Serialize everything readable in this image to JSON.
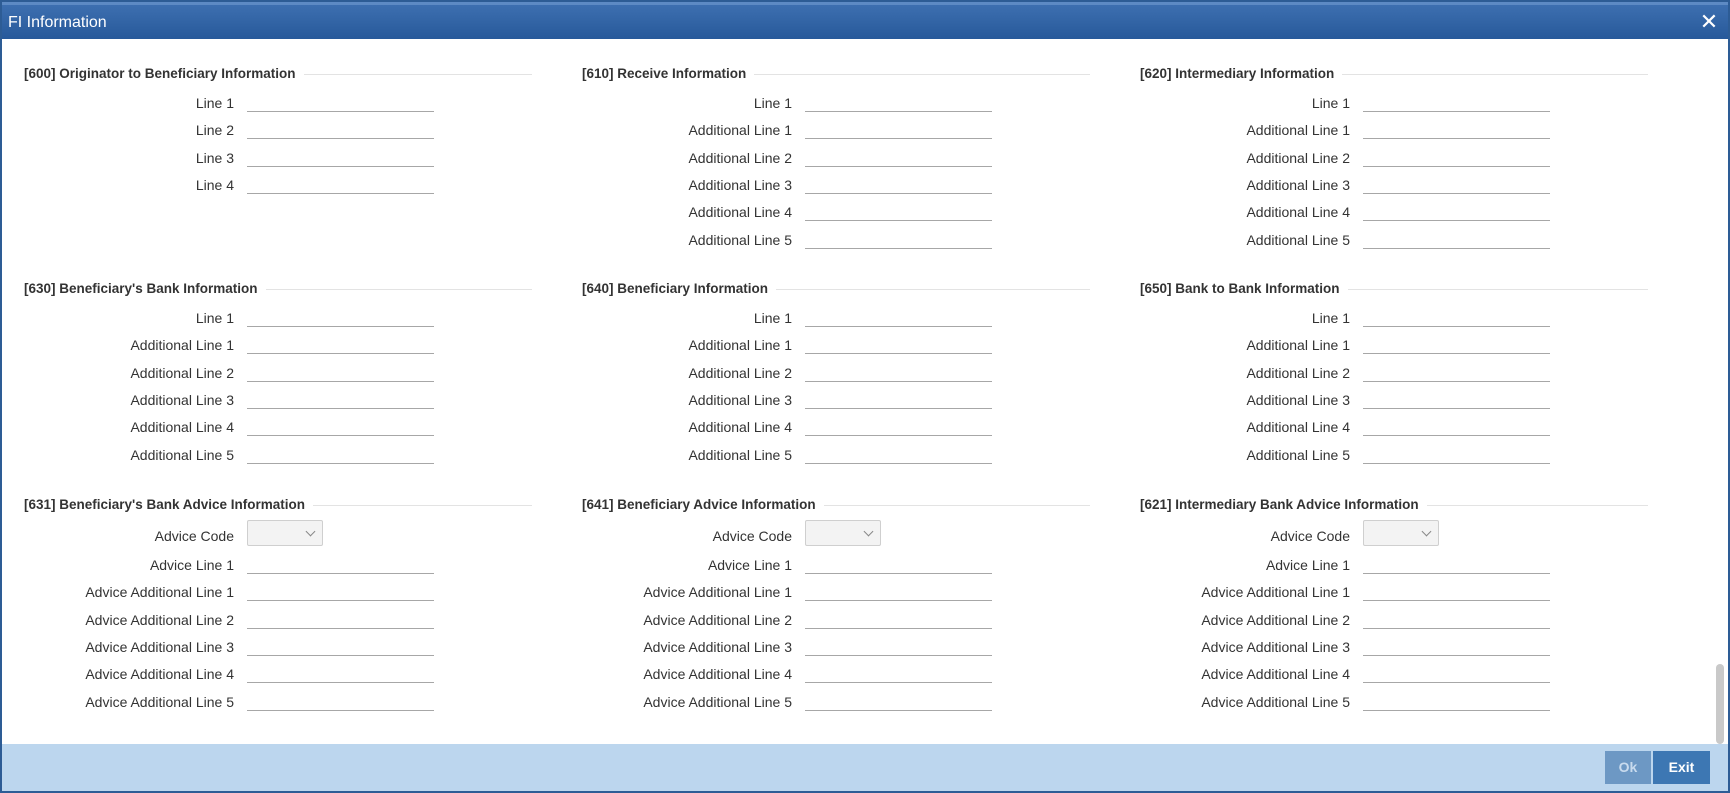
{
  "window": {
    "title": "FI Information"
  },
  "sections": [
    {
      "title": "[600] Originator to Beneficiary Information",
      "rows": [
        {
          "label": "Line 1",
          "type": "text",
          "value": ""
        },
        {
          "label": "Line 2",
          "type": "text",
          "value": ""
        },
        {
          "label": "Line 3",
          "type": "text",
          "value": ""
        },
        {
          "label": "Line 4",
          "type": "text",
          "value": ""
        }
      ]
    },
    {
      "title": "[610] Receive Information",
      "rows": [
        {
          "label": "Line 1",
          "type": "text",
          "value": ""
        },
        {
          "label": "Additional Line 1",
          "type": "text",
          "value": ""
        },
        {
          "label": "Additional Line 2",
          "type": "text",
          "value": ""
        },
        {
          "label": "Additional Line 3",
          "type": "text",
          "value": ""
        },
        {
          "label": "Additional Line 4",
          "type": "text",
          "value": ""
        },
        {
          "label": "Additional Line 5",
          "type": "text",
          "value": ""
        }
      ]
    },
    {
      "title": "[620] Intermediary Information",
      "rows": [
        {
          "label": "Line 1",
          "type": "text",
          "value": ""
        },
        {
          "label": "Additional Line 1",
          "type": "text",
          "value": ""
        },
        {
          "label": "Additional Line 2",
          "type": "text",
          "value": ""
        },
        {
          "label": "Additional Line 3",
          "type": "text",
          "value": ""
        },
        {
          "label": "Additional Line 4",
          "type": "text",
          "value": ""
        },
        {
          "label": "Additional Line 5",
          "type": "text",
          "value": ""
        }
      ]
    },
    {
      "title": "[630] Beneficiary's Bank Information",
      "rows": [
        {
          "label": "Line 1",
          "type": "text",
          "value": ""
        },
        {
          "label": "Additional Line 1",
          "type": "text",
          "value": ""
        },
        {
          "label": "Additional Line 2",
          "type": "text",
          "value": ""
        },
        {
          "label": "Additional Line 3",
          "type": "text",
          "value": ""
        },
        {
          "label": "Additional Line 4",
          "type": "text",
          "value": ""
        },
        {
          "label": "Additional Line 5",
          "type": "text",
          "value": ""
        }
      ]
    },
    {
      "title": "[640] Beneficiary Information",
      "rows": [
        {
          "label": "Line 1",
          "type": "text",
          "value": ""
        },
        {
          "label": "Additional Line 1",
          "type": "text",
          "value": ""
        },
        {
          "label": "Additional Line 2",
          "type": "text",
          "value": ""
        },
        {
          "label": "Additional Line 3",
          "type": "text",
          "value": ""
        },
        {
          "label": "Additional Line 4",
          "type": "text",
          "value": ""
        },
        {
          "label": "Additional Line 5",
          "type": "text",
          "value": ""
        }
      ]
    },
    {
      "title": "[650] Bank to Bank Information",
      "rows": [
        {
          "label": "Line 1",
          "type": "text",
          "value": ""
        },
        {
          "label": "Additional Line 1",
          "type": "text",
          "value": ""
        },
        {
          "label": "Additional Line 2",
          "type": "text",
          "value": ""
        },
        {
          "label": "Additional Line 3",
          "type": "text",
          "value": ""
        },
        {
          "label": "Additional Line 4",
          "type": "text",
          "value": ""
        },
        {
          "label": "Additional Line 5",
          "type": "text",
          "value": ""
        }
      ]
    },
    {
      "title": "[631] Beneficiary's Bank Advice Information",
      "rows": [
        {
          "label": "Advice Code",
          "type": "select",
          "value": ""
        },
        {
          "label": "Advice Line 1",
          "type": "text",
          "value": ""
        },
        {
          "label": "Advice Additional Line 1",
          "type": "text",
          "value": ""
        },
        {
          "label": "Advice Additional Line 2",
          "type": "text",
          "value": ""
        },
        {
          "label": "Advice Additional Line 3",
          "type": "text",
          "value": ""
        },
        {
          "label": "Advice Additional Line 4",
          "type": "text",
          "value": ""
        },
        {
          "label": "Advice Additional Line 5",
          "type": "text",
          "value": ""
        }
      ]
    },
    {
      "title": "[641] Beneficiary Advice Information",
      "rows": [
        {
          "label": "Advice Code",
          "type": "select",
          "value": ""
        },
        {
          "label": "Advice Line 1",
          "type": "text",
          "value": ""
        },
        {
          "label": "Advice Additional Line 1",
          "type": "text",
          "value": ""
        },
        {
          "label": "Advice Additional Line 2",
          "type": "text",
          "value": ""
        },
        {
          "label": "Advice Additional Line 3",
          "type": "text",
          "value": ""
        },
        {
          "label": "Advice Additional Line 4",
          "type": "text",
          "value": ""
        },
        {
          "label": "Advice Additional Line 5",
          "type": "text",
          "value": ""
        }
      ]
    },
    {
      "title": "[621] Intermediary Bank Advice Information",
      "rows": [
        {
          "label": "Advice Code",
          "type": "select",
          "value": ""
        },
        {
          "label": "Advice Line 1",
          "type": "text",
          "value": ""
        },
        {
          "label": "Advice Additional Line 1",
          "type": "text",
          "value": ""
        },
        {
          "label": "Advice Additional Line 2",
          "type": "text",
          "value": ""
        },
        {
          "label": "Advice Additional Line 3",
          "type": "text",
          "value": ""
        },
        {
          "label": "Advice Additional Line 4",
          "type": "text",
          "value": ""
        },
        {
          "label": "Advice Additional Line 5",
          "type": "text",
          "value": ""
        }
      ]
    }
  ],
  "footer": {
    "ok_label": "Ok",
    "exit_label": "Exit"
  },
  "icons": {
    "close": "close-icon",
    "dropdown": "chevron-down-icon"
  },
  "colors": {
    "titlebar": "#2d5c95",
    "footer": "#bcd6ee",
    "exit_button": "#3d77b3",
    "ok_button_disabled": "#6d98c4"
  }
}
